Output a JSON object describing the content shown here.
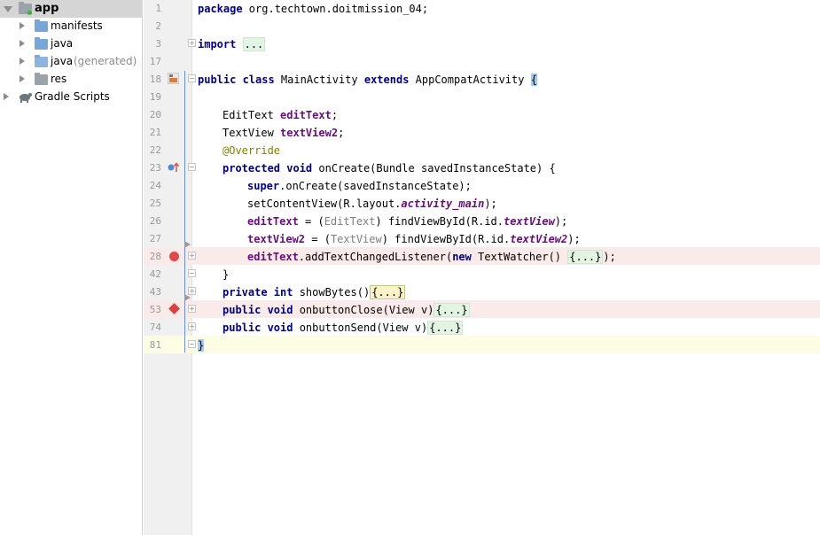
{
  "tree": {
    "items": [
      {
        "label": "app",
        "secondary": ""
      },
      {
        "label": "manifests",
        "secondary": ""
      },
      {
        "label": "java",
        "secondary": ""
      },
      {
        "label": "java",
        "secondary": "(generated)"
      },
      {
        "label": "res",
        "secondary": ""
      },
      {
        "label": "Gradle Scripts",
        "secondary": ""
      }
    ]
  },
  "editor": {
    "line_numbers": [
      "1",
      "2",
      "3",
      "17",
      "18",
      "19",
      "20",
      "21",
      "22",
      "23",
      "24",
      "25",
      "26",
      "27",
      "28",
      "42",
      "43",
      "53",
      "74",
      "81"
    ],
    "code": {
      "l1_kw": "package",
      "l1_rest": " org.techtown.doitmission_04;",
      "l3_kw": "import",
      "l3_fold": "...",
      "l18_kw1": "public class",
      "l18_name": " MainActivity ",
      "l18_kw2": "extends",
      "l18_super": " AppCompatActivity ",
      "l18_brace": "{",
      "l20_type": "EditText ",
      "l20_field": "editText",
      "l20_end": ";",
      "l21_type": "TextView ",
      "l21_field": "textView2",
      "l21_end": ";",
      "l22_anno": "@Override",
      "l23_kw": "protected void",
      "l23_rest": " onCreate(Bundle savedInstanceState) {",
      "l24_kw": "super",
      "l24_rest": ".onCreate(savedInstanceState);",
      "l25_a": "setContentView(R.layout.",
      "l25_i": "activity_main",
      "l25_b": ");",
      "l26_field": "editText",
      "l26_a": " = (",
      "l26_cast": "EditText",
      "l26_b": ") findViewById(R.id.",
      "l26_i": "textView",
      "l26_c": ");",
      "l27_field": "textView2",
      "l27_a": " = (",
      "l27_cast": "TextView",
      "l27_b": ") findViewById(R.id.",
      "l27_i": "textView2",
      "l27_c": ");",
      "l28_field": "editText",
      "l28_a": ".addTextChangedListener(",
      "l28_kw": "new",
      "l28_b": " TextWatcher() ",
      "l28_fold": "{...}",
      "l28_c": ");",
      "l42": "}",
      "l43_kw": "private int",
      "l43_rest": " showBytes()",
      "l43_fold": "{...}",
      "l53_kw": "public void",
      "l53_rest": " onbuttonClose(View v)",
      "l53_fold": "{...}",
      "l74_kw": "public void",
      "l74_rest": " onbuttonSend(View v)",
      "l74_fold": "{...}",
      "l81": "}"
    }
  },
  "colors": {
    "keyword": "#000080",
    "field": "#660e7a",
    "annotation": "#808000",
    "breakpoint": "#e04a4a",
    "selection": "#d5d5d5"
  }
}
